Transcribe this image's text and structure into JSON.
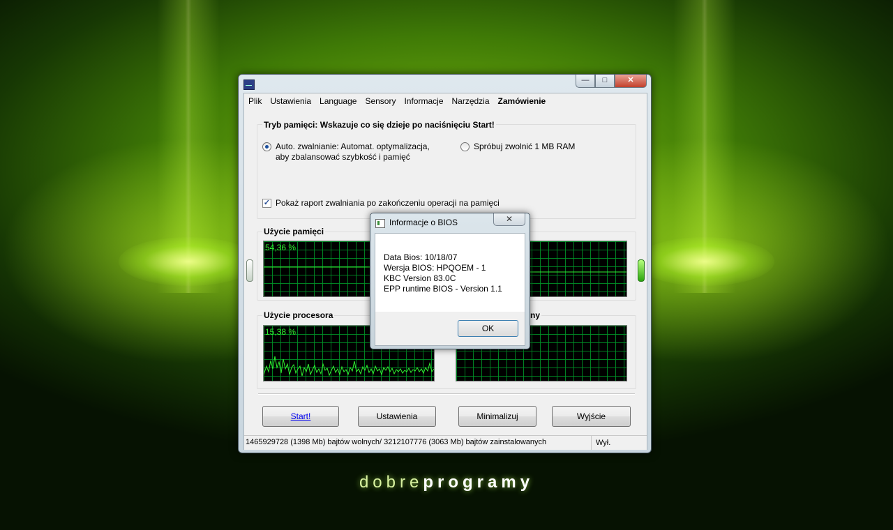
{
  "window": {
    "menu": [
      "Plik",
      "Ustawienia",
      "Language",
      "Sensory",
      "Informacje",
      "Narzędzia",
      "Zamówienie"
    ],
    "memory_mode": {
      "title": "Tryb pamięci: Wskazuje co się dzieje po naciśnięciu Start!",
      "option_auto_line1": "Auto. zwalnianie: Automat. optymalizacja,",
      "option_auto_line2": "aby zbalansować szybkość i pamięć",
      "option_try": "Spróbuj zwolnić 1 MB RAM",
      "checkbox_label": "Pokaż raport zwalniania po zakończeniu operacji na pamięci",
      "checkbox_checked": true,
      "selected_option": "auto"
    },
    "memory_usage": {
      "title": "Użycie pamięci",
      "value": "54,36 %",
      "percent": 54.36
    },
    "cpu_usage": {
      "title": "Użycie procesora",
      "value": "15,38 %",
      "percent": 15.38
    },
    "partial_title_right": "ny",
    "buttons": {
      "start": "Start!",
      "settings": "Ustawienia",
      "minimize": "Minimalizuj",
      "exit": "Wyjście"
    },
    "status": {
      "memory": "1465929728 (1398 Mb) bajtów wolnych/ 3212107776 (3063 Mb) bajtów zainstalowanych",
      "state": "Wył."
    }
  },
  "dialog": {
    "title": "Informacje o BIOS",
    "lines": [
      "Data Bios: 10/18/07",
      "Wersja BIOS: HPQOEM - 1",
      "KBC Version 83.0C",
      "EPP runtime BIOS - Version 1.1"
    ],
    "ok": "OK"
  },
  "brand": {
    "light": "dobre",
    "bold": "programy"
  },
  "colors": {
    "graph_line": "#31f031",
    "graph_grid": "#009628",
    "wallpaper": "#5aa00c"
  }
}
